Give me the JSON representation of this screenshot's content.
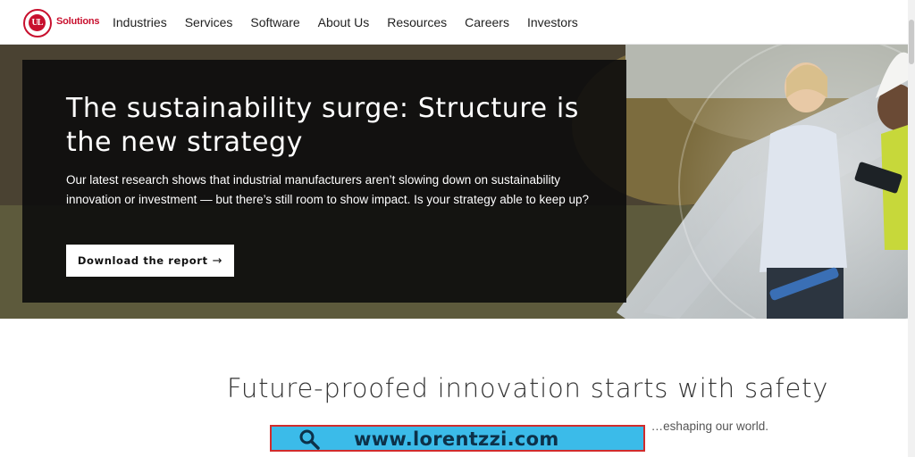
{
  "brand": {
    "logo_mark": "UL",
    "logo_text": "Solutions",
    "accent": "#c8102e"
  },
  "nav": {
    "items": [
      {
        "label": "Industries"
      },
      {
        "label": "Services"
      },
      {
        "label": "Software"
      },
      {
        "label": "About Us"
      },
      {
        "label": "Resources"
      },
      {
        "label": "Careers"
      },
      {
        "label": "Investors"
      }
    ]
  },
  "hero": {
    "title": "The sustainability surge: Structure is the new strategy",
    "body": "Our latest research shows that industrial manufacturers aren’t slowing down on sustainability innovation or investment — but there’s still room to show impact. Is your strategy able to keep up?",
    "cta_label": "Download the report",
    "cta_icon": "arrow-right-icon",
    "card_color": "#0c0c0c"
  },
  "section": {
    "title": "Future-proofed innovation starts with safety",
    "subtitle": "…eshaping our world."
  },
  "watermark": {
    "text": "www.lorentzzi.com",
    "icon": "search-icon",
    "background": "#3bbbe9",
    "border": "#d12c2c"
  }
}
